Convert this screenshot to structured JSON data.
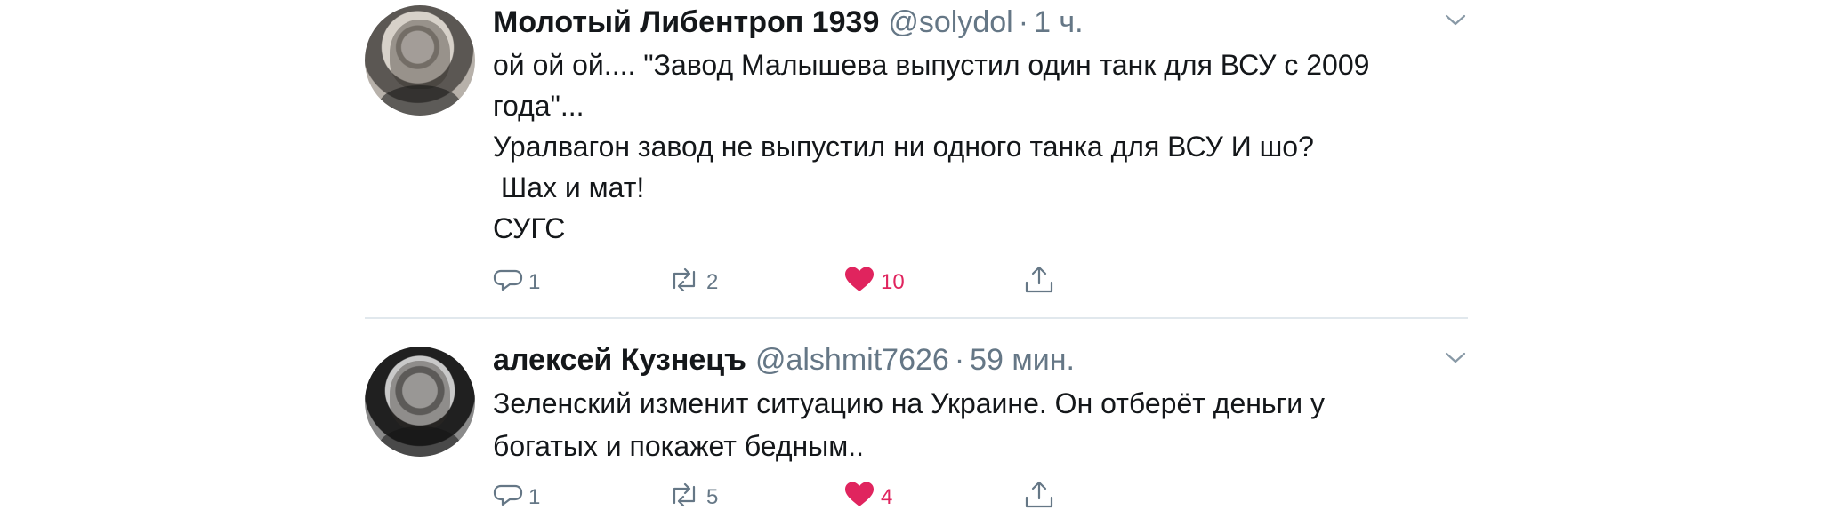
{
  "colors": {
    "primary_text": "#14171a",
    "secondary_text": "#657786",
    "like": "#e0245e",
    "divider": "#e1e8ed",
    "background": "#ffffff"
  },
  "tweets": [
    {
      "name": "Молотый Либентроп 1939",
      "handle": "@solydol",
      "dot": "·",
      "time": "1 ч.",
      "text": "ой ой ой.... \"Завод Малышева выпустил один танк для ВСУ с 2009\nгода\"...\nУралвагон завод не выпустил ни одного танка для ВСУ И шо?\n Шах и мат!\nСУГС",
      "reply_count": "1",
      "retweet_count": "2",
      "like_count": "10",
      "liked": true,
      "avatar_icon": "user-photo-avatar"
    },
    {
      "name": "алексей Кузнецъ",
      "handle": "@alshmit7626",
      "dot": "·",
      "time": "59 мин.",
      "text": "Зеленский изменит ситуацию на Украине. Он отберёт деньги у\nбогатых и покажет бедным..",
      "reply_count": "1",
      "retweet_count": "5",
      "like_count": "4",
      "liked": true,
      "avatar_icon": "user-photo-avatar"
    }
  ]
}
